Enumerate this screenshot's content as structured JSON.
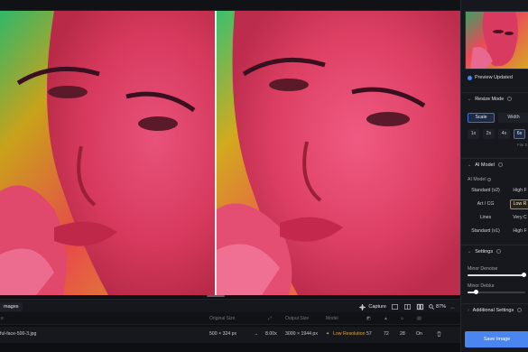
{
  "toolbar": {
    "images_tab": "mages",
    "capture_label": "Capture",
    "zoom_level": "87%"
  },
  "table": {
    "headers": {
      "name": "e",
      "original_size": "Original Size",
      "output_size": "Output Size",
      "model": "Model"
    },
    "row": {
      "name": "ful-face-500-3.jpg",
      "original_size": "500 × 324 px",
      "arrow": "→",
      "scale": "8.00x",
      "output_size": "3000 × 1944 px",
      "model": "Low Resolution",
      "v1": "57",
      "v2": "72",
      "v3": "28",
      "v4": "On"
    }
  },
  "sidebar": {
    "preview_status": "Preview Updated",
    "resize_mode": {
      "title": "Resize Mode",
      "modes": [
        "Scale",
        "Width"
      ],
      "scales": [
        "1x",
        "2x",
        "4x",
        "6x"
      ],
      "hint": "File S"
    },
    "ai_model": {
      "title": "AI Model",
      "label": "AI Model",
      "options": [
        "Standard (v2)",
        "High F",
        "Art / CG",
        "Low R",
        "Lines",
        "Very C",
        "Standard (v1)",
        "High F"
      ]
    },
    "settings": {
      "title": "Settings",
      "minor_denoise_label": "Minor Denoise",
      "minor_denoise_value": 0.97,
      "minor_deblur_label": "Minor Deblur",
      "minor_deblur_value": 0.15
    },
    "additional_settings": {
      "title": "Additional Settings"
    },
    "save_label": "Save Image"
  },
  "colors": {
    "accent": "#4a86f0",
    "warning": "#e6a33c",
    "selected_border": "#b8892e"
  }
}
